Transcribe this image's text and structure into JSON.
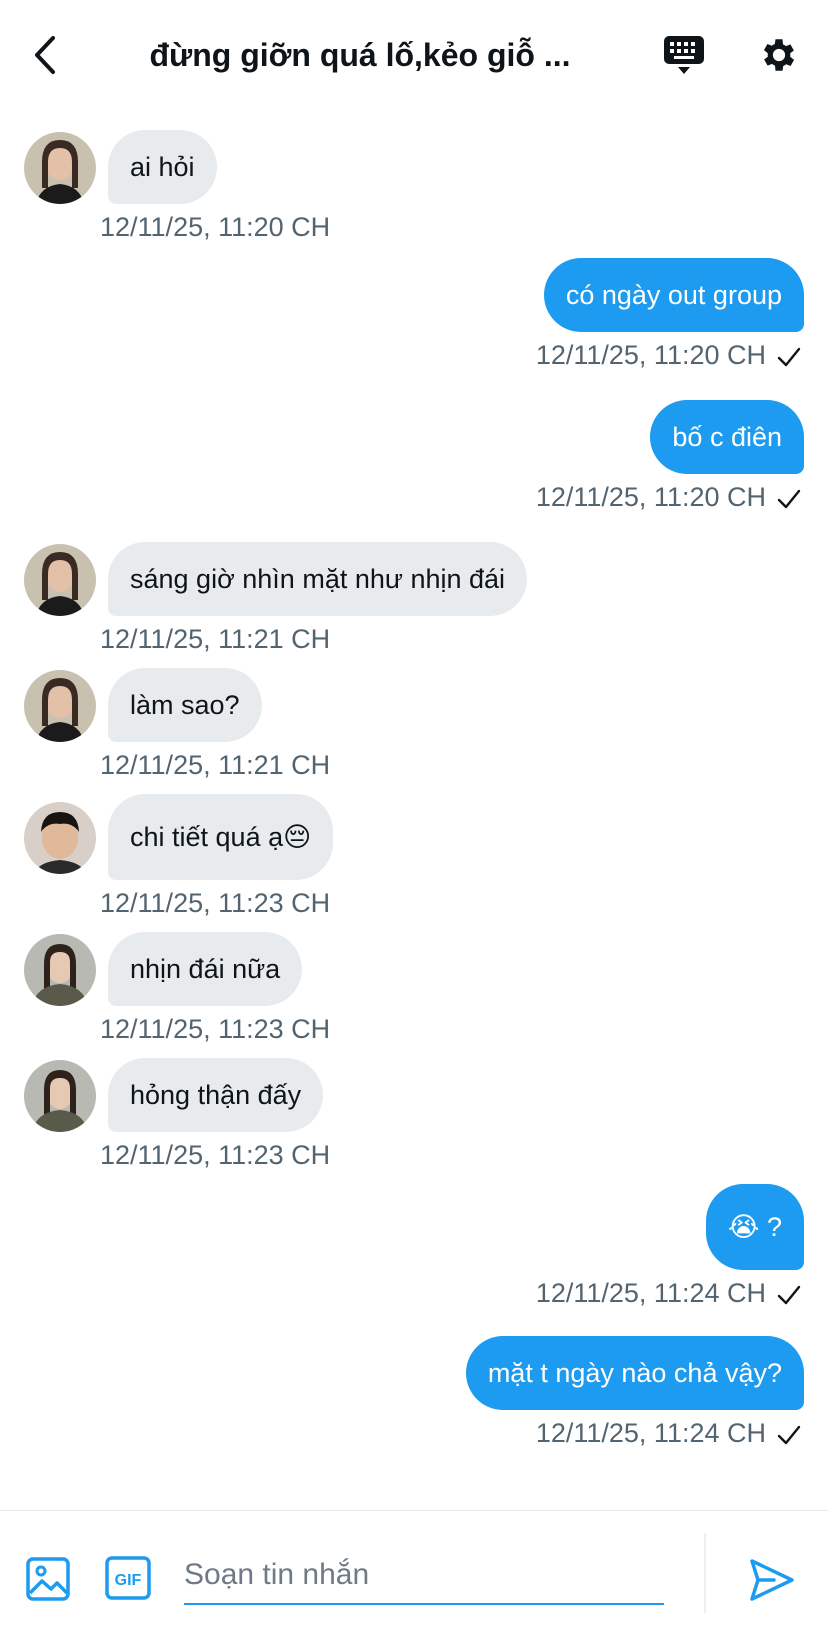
{
  "header": {
    "title": "đừng giỡn quá lố,kẻo giỗ ...",
    "back_icon": "chevron-left-icon",
    "keyboard_icon": "keyboard-icon",
    "settings_icon": "gear-icon"
  },
  "colors": {
    "accent": "#1d9bf0",
    "incoming_bubble": "#e8ebee",
    "timestamp": "#536471"
  },
  "messages": [
    {
      "direction": "in",
      "text": "ai hỏi",
      "time": "12/11/25, 11:20 CH"
    },
    {
      "direction": "out",
      "text": "có ngày out group",
      "time": "12/11/25, 11:20 CH"
    },
    {
      "direction": "out",
      "text": "bố c điên",
      "time": "12/11/25, 11:20 CH"
    },
    {
      "direction": "in",
      "text": "sáng giờ nhìn mặt như nhịn đái",
      "time": "12/11/25, 11:21 CH"
    },
    {
      "direction": "in",
      "text": "làm sao?",
      "time": "12/11/25, 11:21 CH"
    },
    {
      "direction": "in",
      "text": "chi tiết quá ạ😔",
      "time": "12/11/25, 11:23 CH"
    },
    {
      "direction": "in",
      "text": "nhịn đái nữa",
      "time": "12/11/25, 11:23 CH"
    },
    {
      "direction": "in",
      "text": "hỏng thận đấy",
      "time": "12/11/25, 11:23 CH"
    },
    {
      "direction": "out",
      "text": "😭 ?",
      "time": "12/11/25, 11:24 CH"
    },
    {
      "direction": "out",
      "text": "mặt t ngày nào chả vậy?",
      "time": "12/11/25, 11:24 CH"
    }
  ],
  "composer": {
    "placeholder": "Soạn tin nhắn",
    "media_icon": "image-icon",
    "gif_label": "GIF",
    "send_icon": "send-icon"
  }
}
